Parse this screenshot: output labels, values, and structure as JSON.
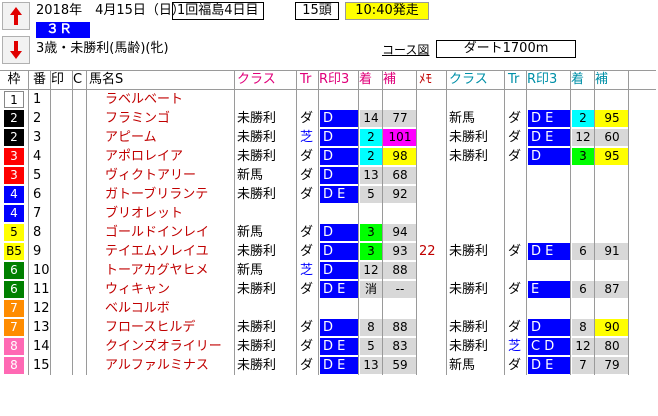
{
  "header": {
    "race_date": "2018年　4月15日（日）",
    "meeting": "1回福島4日目",
    "runners": "15頭",
    "start_time": "10:40発走",
    "race_no": "３Ｒ",
    "race_condition": "3歳・未勝利(馬齢)(牝)",
    "course_link": "コース図",
    "course": "ダート1700m"
  },
  "columns": {
    "waku": "枠",
    "ban": "番",
    "in": "印",
    "c": "C",
    "name": "馬名S",
    "cls1": "クラス",
    "tr1": "Tr",
    "rf1": "R印3",
    "ch1": "着",
    "ho1": "補",
    "me": "ﾒﾓ",
    "cls2": "クラス",
    "tr2": "Tr",
    "rf2": "R印3",
    "ch2": "着",
    "ho2": "補"
  },
  "colors": {
    "waku": {
      "1": "#ffffff",
      "2": "#000000",
      "3": "#ff0000",
      "4": "#0000ff",
      "5": "#ffff00",
      "6": "#008000",
      "7": "#ff8c00",
      "8": "#ff69b4"
    },
    "rf_bg": "#0000ff",
    "ch_bg": {
      "lime": "#00ff00",
      "cyan": "#00ffff",
      "grey": "#d8d8d8"
    },
    "ho_bg": {
      "yellow": "#ffff00",
      "grey": "#d8d8d8",
      "magenta": "#ff00ff"
    }
  },
  "horses": [
    {
      "waku": "1",
      "waku_color": "1",
      "ban": "1",
      "name": "ラベルベート",
      "r1": null,
      "memo": "",
      "r2": null
    },
    {
      "waku": "2",
      "waku_color": "2",
      "ban": "2",
      "name": "フラミンゴ",
      "r1": {
        "cls": "未勝利",
        "tr": "ダ",
        "rf": "D",
        "ch": "14",
        "ch_bg": "grey",
        "ho": "77",
        "ho_bg": "grey"
      },
      "memo": "",
      "r2": {
        "cls": "新馬",
        "tr": "ダ",
        "rf": "D E",
        "ch": "2",
        "ch_bg": "cyan",
        "ho": "95",
        "ho_bg": "yellow"
      }
    },
    {
      "waku": "2",
      "waku_color": "2",
      "ban": "3",
      "name": "アピーム",
      "r1": {
        "cls": "未勝利",
        "tr": "芝",
        "rf": "D",
        "ch": "2",
        "ch_bg": "cyan",
        "ho": "101",
        "ho_bg": "magenta"
      },
      "memo": "",
      "r2": {
        "cls": "未勝利",
        "tr": "ダ",
        "rf": "D E",
        "ch": "12",
        "ch_bg": "grey",
        "ho": "60",
        "ho_bg": "grey"
      }
    },
    {
      "waku": "3",
      "waku_color": "3",
      "ban": "4",
      "name": "アポロレイア",
      "r1": {
        "cls": "未勝利",
        "tr": "ダ",
        "rf": "D",
        "ch": "2",
        "ch_bg": "cyan",
        "ho": "98",
        "ho_bg": "yellow"
      },
      "memo": "",
      "r2": {
        "cls": "未勝利",
        "tr": "ダ",
        "rf": "D",
        "ch": "3",
        "ch_bg": "lime",
        "ho": "95",
        "ho_bg": "yellow"
      }
    },
    {
      "waku": "3",
      "waku_color": "3",
      "ban": "5",
      "name": "ヴィクトアリー",
      "r1": {
        "cls": "新馬",
        "tr": "ダ",
        "rf": "D",
        "ch": "13",
        "ch_bg": "grey",
        "ho": "68",
        "ho_bg": "grey"
      },
      "memo": "",
      "r2": null
    },
    {
      "waku": "4",
      "waku_color": "4",
      "ban": "6",
      "name": "ガトーブリランテ",
      "r1": {
        "cls": "未勝利",
        "tr": "ダ",
        "rf": "D E",
        "ch": "5",
        "ch_bg": "grey",
        "ho": "92",
        "ho_bg": "grey"
      },
      "memo": "",
      "r2": null
    },
    {
      "waku": "4",
      "waku_color": "4",
      "ban": "7",
      "name": "ブリオレット",
      "r1": null,
      "memo": "",
      "r2": null
    },
    {
      "waku": "5",
      "waku_color": "5",
      "ban": "8",
      "name": "ゴールドインレイ",
      "r1": {
        "cls": "新馬",
        "tr": "ダ",
        "rf": "D",
        "ch": "3",
        "ch_bg": "lime",
        "ho": "94",
        "ho_bg": "grey"
      },
      "memo": "",
      "r2": null
    },
    {
      "waku": "B5",
      "waku_color": "5",
      "ban": "9",
      "name": "テイエムソレイユ",
      "r1": {
        "cls": "未勝利",
        "tr": "ダ",
        "rf": "D",
        "ch": "3",
        "ch_bg": "lime",
        "ho": "93",
        "ho_bg": "grey"
      },
      "memo": "22",
      "r2": {
        "cls": "未勝利",
        "tr": "ダ",
        "rf": "D E",
        "ch": "6",
        "ch_bg": "grey",
        "ho": "91",
        "ho_bg": "grey"
      }
    },
    {
      "waku": "6",
      "waku_color": "6",
      "ban": "10",
      "name": "トーアカグヤヒメ",
      "r1": {
        "cls": "新馬",
        "tr": "芝",
        "rf": "D",
        "ch": "12",
        "ch_bg": "grey",
        "ho": "88",
        "ho_bg": "grey"
      },
      "memo": "",
      "r2": null
    },
    {
      "waku": "6",
      "waku_color": "6",
      "ban": "11",
      "name": "ウィキャン",
      "r1": {
        "cls": "未勝利",
        "tr": "ダ",
        "rf": "D E",
        "ch": "消",
        "ch_bg": "grey",
        "ho": "--",
        "ho_bg": "grey"
      },
      "memo": "",
      "r2": {
        "cls": "未勝利",
        "tr": "ダ",
        "rf": "E",
        "ch": "6",
        "ch_bg": "grey",
        "ho": "87",
        "ho_bg": "grey"
      }
    },
    {
      "waku": "7",
      "waku_color": "7",
      "ban": "12",
      "name": "ベルコルボ",
      "r1": null,
      "memo": "",
      "r2": null
    },
    {
      "waku": "7",
      "waku_color": "7",
      "ban": "13",
      "name": "フロースヒルデ",
      "r1": {
        "cls": "未勝利",
        "tr": "ダ",
        "rf": "D",
        "ch": "8",
        "ch_bg": "grey",
        "ho": "88",
        "ho_bg": "grey"
      },
      "memo": "",
      "r2": {
        "cls": "未勝利",
        "tr": "ダ",
        "rf": "D",
        "ch": "8",
        "ch_bg": "grey",
        "ho": "90",
        "ho_bg": "yellow"
      }
    },
    {
      "waku": "8",
      "waku_color": "8",
      "ban": "14",
      "name": "クインズオライリー",
      "r1": {
        "cls": "未勝利",
        "tr": "ダ",
        "rf": "D E",
        "ch": "5",
        "ch_bg": "grey",
        "ho": "83",
        "ho_bg": "grey"
      },
      "memo": "",
      "r2": {
        "cls": "未勝利",
        "tr": "芝",
        "rf": "C D",
        "ch": "12",
        "ch_bg": "grey",
        "ho": "80",
        "ho_bg": "grey"
      }
    },
    {
      "waku": "8",
      "waku_color": "8",
      "ban": "15",
      "name": "アルファルミナス",
      "r1": {
        "cls": "未勝利",
        "tr": "ダ",
        "rf": "D E",
        "ch": "13",
        "ch_bg": "grey",
        "ho": "59",
        "ho_bg": "grey"
      },
      "memo": "",
      "r2": {
        "cls": "新馬",
        "tr": "ダ",
        "rf": "D E",
        "ch": "7",
        "ch_bg": "grey",
        "ho": "79",
        "ho_bg": "grey"
      }
    }
  ]
}
